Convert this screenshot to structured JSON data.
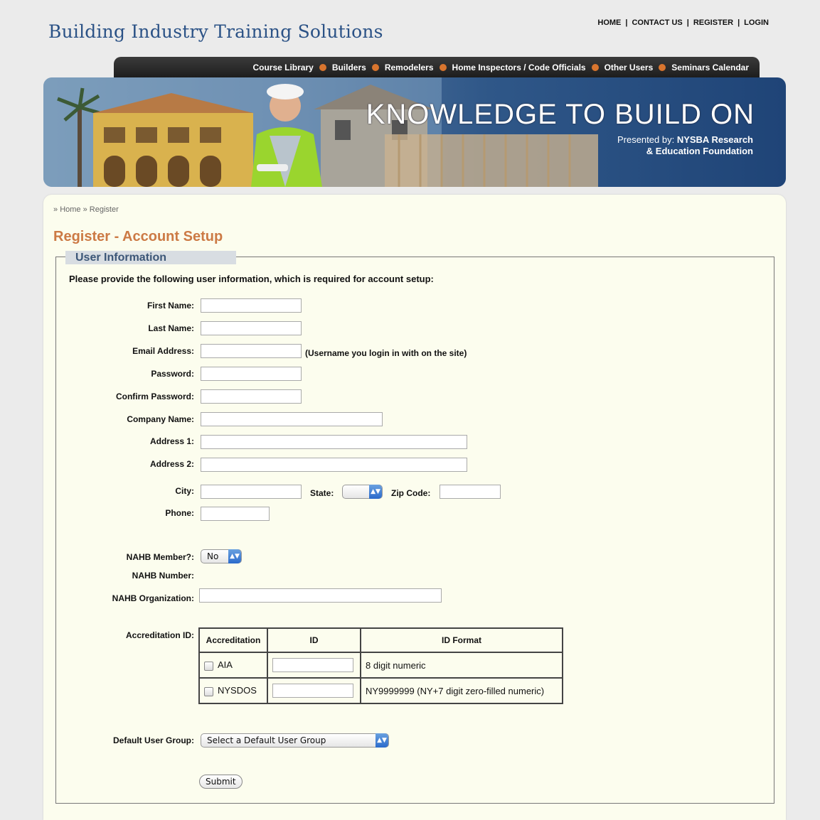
{
  "site": {
    "title": "Building Industry Training Solutions",
    "top_links": [
      "HOME",
      "CONTACT US",
      "REGISTER",
      "LOGIN"
    ]
  },
  "nav": {
    "items": [
      "Course Library",
      "Builders",
      "Remodelers",
      "Home Inspectors / Code Officials",
      "Other Users",
      "Seminars Calendar"
    ],
    "accent_color": "#d9752e"
  },
  "banner": {
    "headline": "KNOWLEDGE TO BUILD ON",
    "presented_prefix": "Presented by:",
    "presented_org_line1": "NYSBA Research",
    "presented_org_line2": "& Education Foundation"
  },
  "breadcrumb": {
    "home": "Home",
    "current": "Register"
  },
  "page": {
    "title": "Register - Account Setup",
    "section_title": "User Information",
    "intro": "Please provide the following user information, which is required for account setup:"
  },
  "form": {
    "first_name_label": "First Name:",
    "last_name_label": "Last Name:",
    "email_label": "Email Address:",
    "email_hint": "(Username you login in with on the site)",
    "password_label": "Password:",
    "confirm_password_label": "Confirm Password:",
    "company_label": "Company Name:",
    "address1_label": "Address 1:",
    "address2_label": "Address 2:",
    "city_label": "City:",
    "state_label": "State:",
    "state_value": "",
    "zip_label": "Zip Code:",
    "phone_label": "Phone:",
    "nahb_member_label": "NAHB Member?:",
    "nahb_member_value": "No",
    "nahb_number_label": "NAHB Number:",
    "nahb_org_label": "NAHB Organization:",
    "accreditation_label": "Accreditation ID:",
    "default_group_label": "Default User Group:",
    "default_group_value": "Select a Default User Group",
    "submit_label": "Submit"
  },
  "accreditation": {
    "headers": [
      "Accreditation",
      "ID",
      "ID Format"
    ],
    "rows": [
      {
        "name": "AIA",
        "format": "8 digit numeric"
      },
      {
        "name": "NYSDOS",
        "format": "NY9999999 (NY+7 digit zero-filled numeric)"
      }
    ]
  },
  "colors": {
    "title_blue": "#2b5286",
    "page_title_orange": "#cc7a45",
    "content_bg": "#fcfdee"
  }
}
